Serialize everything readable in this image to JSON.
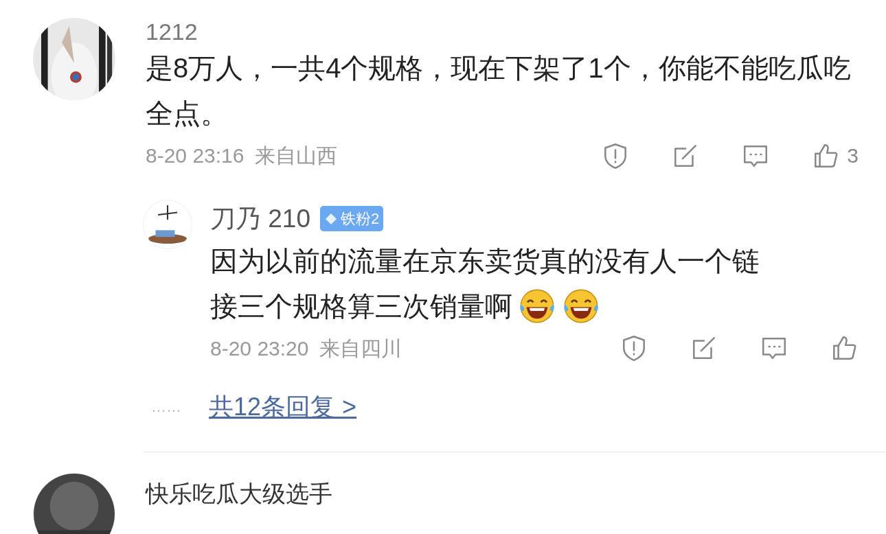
{
  "comments": [
    {
      "username": "1212",
      "avatar": {
        "kind": "picture"
      },
      "text": "是8万人，一共4个规格，现在下架了1个，你能不能吃瓜吃全点。",
      "time": "8-20 23:16",
      "location": "来自山西",
      "likes": "3",
      "replies": [
        {
          "username": "刀乃 210",
          "avatar": {
            "kind": "picture"
          },
          "badge": "铁粉2",
          "text_lines": [
            "因为以前的流量在京东卖货真的没有人一个链",
            "接三个规格算三次销量啊"
          ],
          "emojis": [
            {
              "kind": "laugh-cry"
            },
            {
              "kind": "laugh-cry"
            }
          ],
          "time": "8-20 23:20",
          "location": "来自四川"
        }
      ],
      "more_replies": {
        "dots": "……",
        "label": "共12条回复 >"
      }
    },
    {
      "username": "快乐吃瓜大级选手",
      "avatar": {
        "kind": "picture"
      }
    }
  ]
}
